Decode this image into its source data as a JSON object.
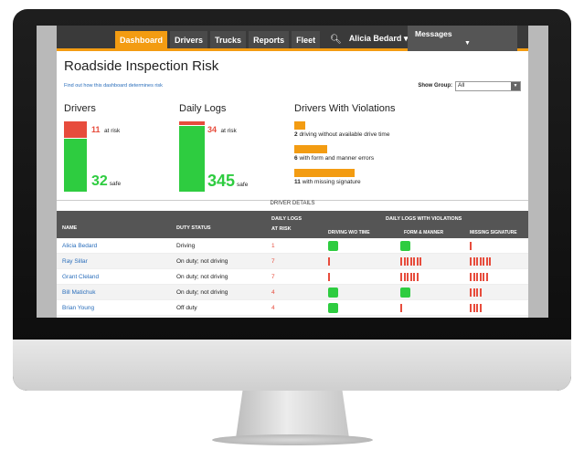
{
  "nav": {
    "tabs": [
      "Dashboard",
      "Drivers",
      "Trucks",
      "Reports",
      "Fleet"
    ],
    "active": 0,
    "user": "Alicia Bedard",
    "messages": "Messages"
  },
  "page": {
    "title": "Roadside Inspection Risk",
    "help_link": "Find out how this dashboard determines risk",
    "show_group_label": "Show Group:",
    "show_group_value": "All"
  },
  "drivers": {
    "heading": "Drivers",
    "at_risk": "11",
    "at_risk_label": "at risk",
    "safe": "32",
    "safe_label": "safe"
  },
  "daily_logs": {
    "heading": "Daily Logs",
    "at_risk": "34",
    "at_risk_label": "at risk",
    "safe": "345",
    "safe_label": "safe"
  },
  "violations": {
    "heading": "Drivers With Violations",
    "items": [
      {
        "count": "2",
        "text": "driving without available drive time",
        "fraction": 0.18
      },
      {
        "count": "6",
        "text": "with form and manner errors",
        "fraction": 0.55
      },
      {
        "count": "11",
        "text": "with missing signature",
        "fraction": 1.0
      }
    ]
  },
  "table": {
    "caption": "DRIVER DETAILS",
    "headers": {
      "name": "NAME",
      "duty": "DUTY STATUS",
      "logs": "DAILY LOGS",
      "logs2": "AT RISK",
      "violations_group": "DAILY LOGS WITH VIOLATIONS",
      "driving": "DRIVING W/O TIME",
      "form": "FORM & MANNER",
      "signature": "MISSING SIGNATURE"
    },
    "rows": [
      {
        "name": "Alicia Bedard",
        "status": "Driving",
        "logs": "1",
        "driving": "ok",
        "form": "ok",
        "signature": 1
      },
      {
        "name": "Ray Sillar",
        "status": "On duty; not driving",
        "logs": "7",
        "driving": 1,
        "form": 7,
        "signature": 7
      },
      {
        "name": "Grant Cleland",
        "status": "On duty; not driving",
        "logs": "7",
        "driving": 1,
        "form": 6,
        "signature": 6
      },
      {
        "name": "Bill Matichuk",
        "status": "On duty; not driving",
        "logs": "4",
        "driving": "ok",
        "form": "ok",
        "signature": 4
      },
      {
        "name": "Brian Young",
        "status": "Off duty",
        "logs": "4",
        "driving": "ok",
        "form": 1,
        "signature": 4
      }
    ]
  },
  "colors": {
    "accent": "#f39c12",
    "risk": "#e74c3c",
    "safe": "#2ecc40",
    "link": "#2a6ebb"
  }
}
